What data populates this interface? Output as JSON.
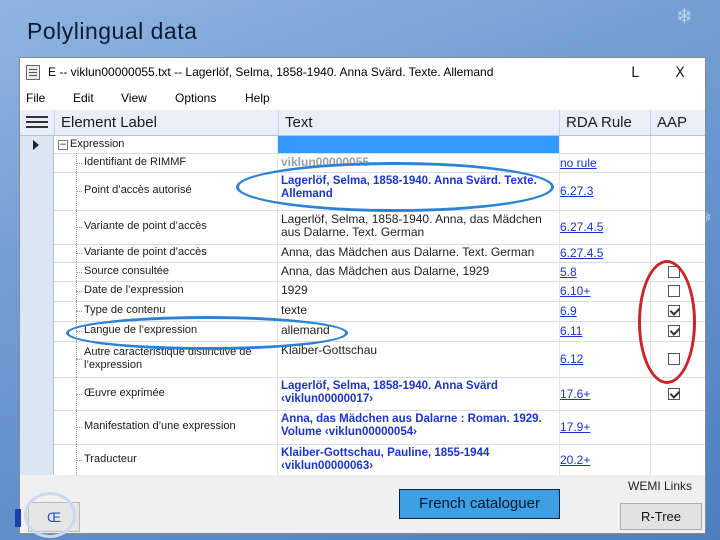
{
  "slide": {
    "title": "Polylingual data"
  },
  "window": {
    "title": "E -- viklun00000055.txt -- Lagerlöf, Selma, 1858-1940. Anna Svärd. Texte. Allemand",
    "minimize": "L",
    "close": "X"
  },
  "menu": [
    "File",
    "Edit",
    "View",
    "Options",
    "Help"
  ],
  "columns": {
    "label": "Element Label",
    "text": "Text",
    "rule": "RDA Rule",
    "aap": "AAP"
  },
  "rows": [
    {
      "label": "Expression",
      "text": "",
      "rule": "",
      "aap": null
    },
    {
      "label": "Identifiant de RIMMF",
      "text": "viklun00000055",
      "rule": "no rule",
      "aap": null
    },
    {
      "label": "Point d’accès autorisé",
      "text": "Lagerlöf, Selma, 1858-1940. Anna Svärd. Texte. Allemand",
      "rule": "6.27.3",
      "aap": null
    },
    {
      "label": "Variante de point d’accès",
      "text": "Lagerlöf, Selma, 1858-1940. Anna, das Mädchen aus Dalarne. Text. German",
      "rule": "6.27.4.5",
      "aap": null
    },
    {
      "label": "Variante de point d’accès",
      "text": "Anna, das Mädchen aus Dalarne. Text. German",
      "rule": "6.27.4.5",
      "aap": null
    },
    {
      "label": "Source consultée",
      "text": "Anna, das Mädchen aus Dalarne, 1929",
      "rule": "5.8",
      "aap": false
    },
    {
      "label": "Date de l’expression",
      "text": "1929",
      "rule": "6.10+",
      "aap": false
    },
    {
      "label": "Type de contenu",
      "text": "texte",
      "rule": "6.9",
      "aap": true
    },
    {
      "label": "Langue de l’expression",
      "text": "allemand",
      "rule": "6.11",
      "aap": true
    },
    {
      "label": "Autre caractéristique distinctive de l’expression",
      "text": "Klaiber-Gottschau",
      "rule": "6.12",
      "aap": false
    },
    {
      "label": "Œuvre exprimée",
      "text": "Lagerlöf, Selma, 1858-1940. Anna Svärd ‹viklun00000017›",
      "rule": "17.6+",
      "aap": true
    },
    {
      "label": "Manifestation d’une expression",
      "text": "Anna, das Mädchen aus Dalarne : Roman. 1929. Volume ‹viklun00000054›",
      "rule": "17.9+",
      "aap": null
    },
    {
      "label": "Traducteur",
      "text": "Klaiber-Gottschau, Pauline, 1855-1944 ‹viklun00000063›",
      "rule": "20.2+",
      "aap": null
    }
  ],
  "bottom": {
    "wemi_links": "WEMI Links",
    "rtree": "R-Tree",
    "language_button": "Œ"
  },
  "overlay": {
    "french_label": "French cataloguer"
  },
  "colors": {
    "link": "#1a35c9",
    "selection": "#3399ff",
    "highlight_blue": "#2d82d4",
    "highlight_red": "#c9252b"
  }
}
